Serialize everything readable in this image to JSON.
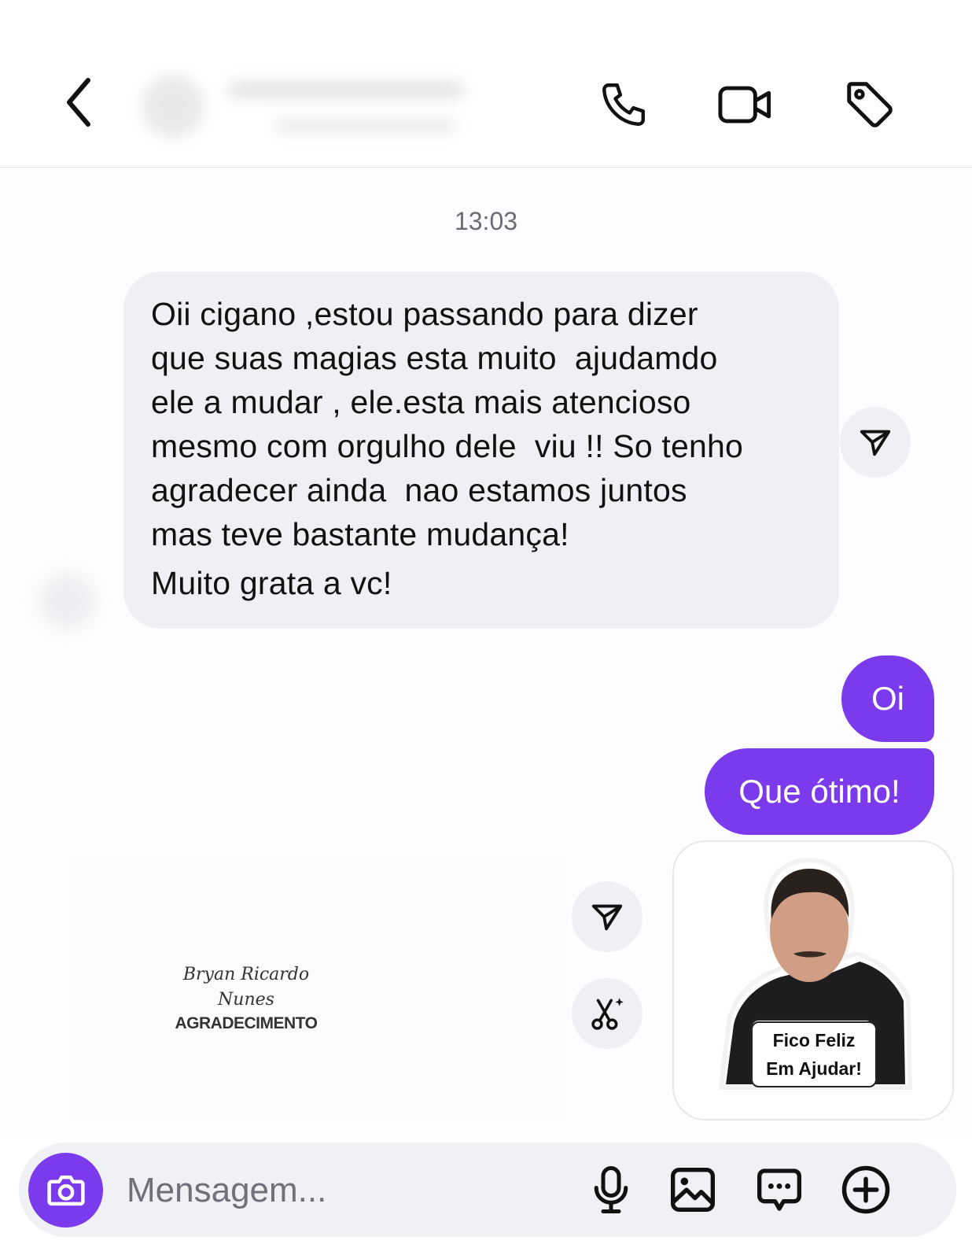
{
  "header": {
    "back_icon": "chevron-left-icon",
    "actions": [
      "phone-icon",
      "video-camera-icon",
      "tag-icon"
    ]
  },
  "conversation": {
    "timestamp": "13:03",
    "incoming_message": {
      "lines": [
        "Oii cigano ,estou passando para dizer",
        "que suas magias esta muito  ajudamdo",
        "ele a mudar , ele.esta mais atencioso",
        "mesmo com orgulho dele  viu !! So tenho",
        "agradecer ainda  nao estamos juntos",
        "mas teve bastante mudança!",
        "Muito grata a vc!"
      ]
    },
    "outgoing_messages": [
      "Oi",
      "Que ótimo!"
    ],
    "signature": {
      "name_line1": "Bryan Ricardo",
      "name_line2": "Nunes",
      "caption": "AGRADECIMENTO"
    },
    "sticker": {
      "caption_line1": "Fico Feliz",
      "caption_line2": "Em Ajudar!"
    }
  },
  "composer": {
    "placeholder": "Mensagem...",
    "icons": [
      "camera-icon",
      "microphone-icon",
      "image-icon",
      "chat-bubble-icon",
      "plus-circle-icon"
    ]
  },
  "colors": {
    "accent": "#7b3aec",
    "incoming_bubble": "#eff0f3",
    "background": "#ffffff"
  }
}
